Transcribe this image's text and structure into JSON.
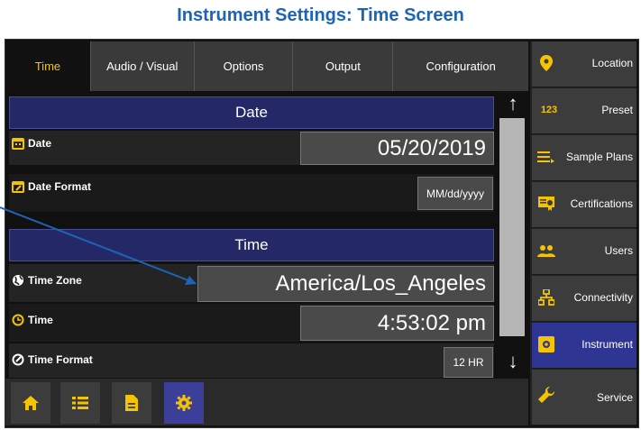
{
  "page_title": "Instrument Settings: Time Screen",
  "tabs": [
    {
      "label": "Time",
      "active": true
    },
    {
      "label": "Audio / Visual",
      "active": false
    },
    {
      "label": "Options",
      "active": false
    },
    {
      "label": "Output",
      "active": false
    },
    {
      "label": "Configuration",
      "active": false
    }
  ],
  "date_section": {
    "title": "Date",
    "date_label": "Date",
    "date_value": "05/20/2019",
    "format_label": "Date Format",
    "format_value": "MM/dd/yyyy"
  },
  "time_section": {
    "title": "Time",
    "zone_label": "Time Zone",
    "zone_value": "America/Los_Angeles",
    "time_label": "Time",
    "time_value": "4:53:02 pm",
    "format_label": "Time Format",
    "format_value": "12 HR"
  },
  "side_nav": [
    {
      "label": "Location",
      "icon": "location-pin-icon"
    },
    {
      "label": "Preset",
      "icon": "numbers-123-icon"
    },
    {
      "label": "Sample Plans",
      "icon": "list-arrow-icon"
    },
    {
      "label": "Certifications",
      "icon": "certificate-icon"
    },
    {
      "label": "Users",
      "icon": "users-icon"
    },
    {
      "label": "Connectivity",
      "icon": "network-icon"
    },
    {
      "label": "Instrument",
      "icon": "instrument-gear-icon",
      "active": true
    },
    {
      "label": "Service",
      "icon": "wrench-icon"
    }
  ],
  "bottom_nav": [
    "home-icon",
    "list-icon",
    "document-icon",
    "gear-icon"
  ],
  "colors": {
    "accent": "#f5c400",
    "header_blue": "#252866",
    "active_blue": "#2f3593",
    "title_blue": "#1e64b4"
  }
}
